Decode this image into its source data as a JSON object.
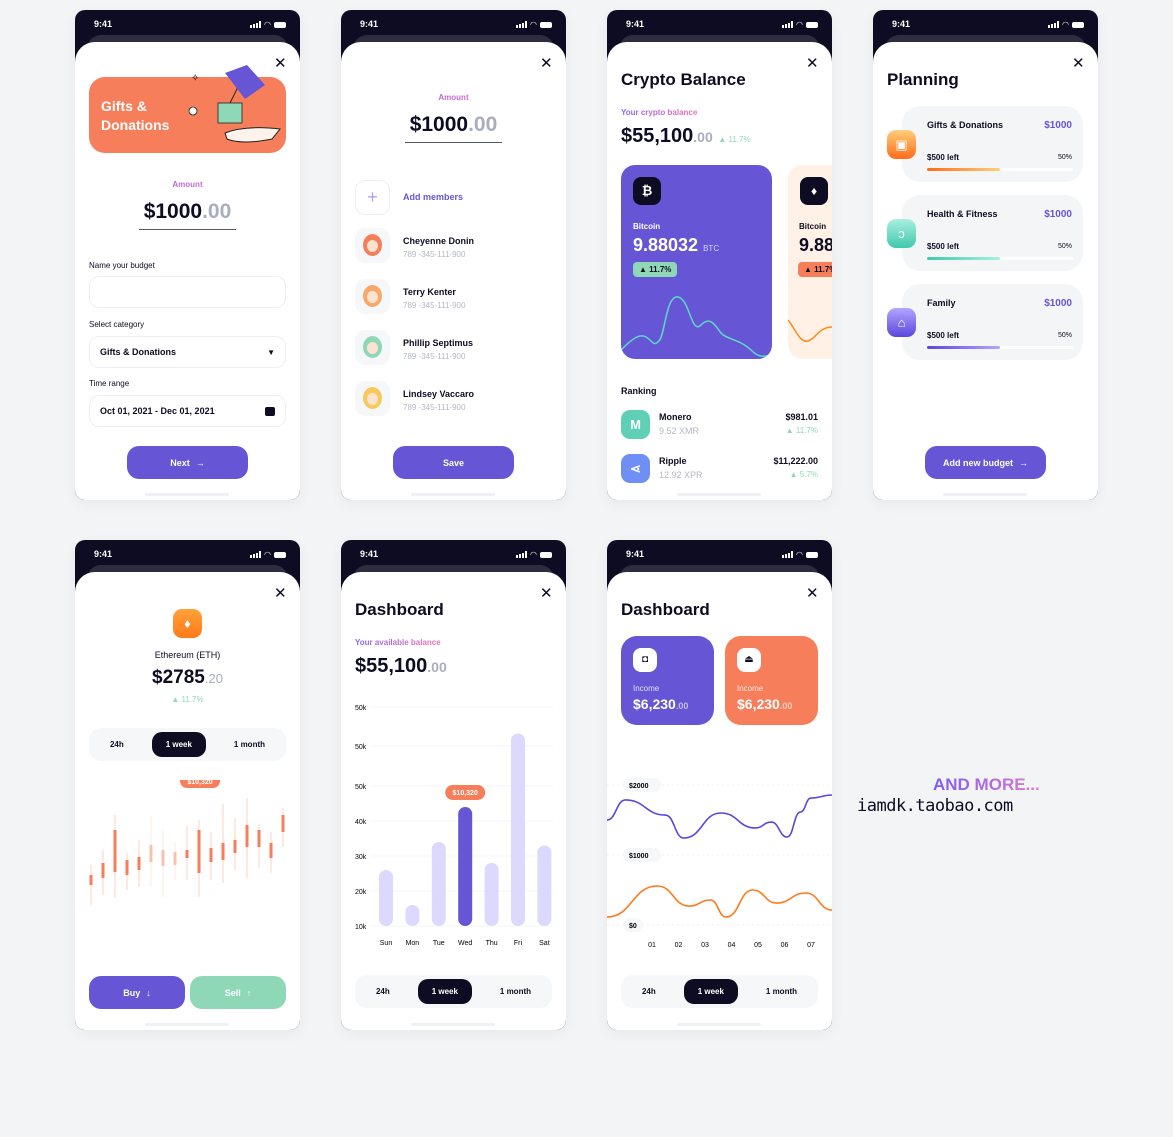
{
  "status": {
    "time": "9:41"
  },
  "colors": {
    "purple": "#6656d6",
    "orange": "#f77e5a",
    "green": "#8ed8b8",
    "dark": "#0d0c22"
  },
  "screen1": {
    "banner_title": "Gifts & Donations",
    "amount_label": "Amount",
    "amount": "$1000",
    "cents": ".00",
    "name_label": "Name your budget",
    "name_value": "",
    "category_label": "Select category",
    "category_value": "Gifts & Donations",
    "range_label": "Time range",
    "range_value": "Oct 01, 2021 - Dec 01, 2021",
    "next": "Next"
  },
  "screen2": {
    "amount_label": "Amount",
    "amount": "$1000",
    "cents": ".00",
    "add_members": "Add members",
    "members": [
      {
        "name": "Cheyenne Donin",
        "phone": "789 -345-111-900",
        "color": "#f77e5a"
      },
      {
        "name": "Terry Kenter",
        "phone": "789 -345-111-900",
        "color": "#f9a86a"
      },
      {
        "name": "Phillip Septimus",
        "phone": "789 -345-111-900",
        "color": "#8ed8b8"
      },
      {
        "name": "Lindsey Vaccaro",
        "phone": "789 -345-111-900",
        "color": "#f8c95a"
      }
    ],
    "save": "Save"
  },
  "screen3": {
    "title": "Crypto Balance",
    "balance_label": "Your crypto balance",
    "balance": "$55,100",
    "cents": ".00",
    "change": "11.7%",
    "card1": {
      "name": "Bitcoin",
      "amount": "9.88032",
      "unit": "BTC",
      "change": "11.7%",
      "icon": "bitcoin-icon"
    },
    "card2": {
      "name": "Bitcoin",
      "amount": "9.88",
      "change": "11.7%",
      "icon": "ethereum-icon"
    },
    "ranking_label": "Ranking",
    "ranking": [
      {
        "name": "Monero",
        "amount": "9.52 XMR",
        "value": "$981.01",
        "change": "11.7%",
        "icon": "monero-icon",
        "color": "#5fd0b6"
      },
      {
        "name": "Ripple",
        "amount": "12.92 XPR",
        "value": "$11,222.00",
        "change": "5.7%",
        "icon": "ripple-icon",
        "color": "#6f8ff5"
      }
    ]
  },
  "screen4": {
    "title": "Planning",
    "budgets": [
      {
        "name": "Gifts & Donations",
        "amount": "$1000",
        "left": "$500 left",
        "percent": "50%",
        "progress": 0.5,
        "icon": "gift-icon",
        "c1": "#ff6b1a",
        "c2": "#ffcf7a"
      },
      {
        "name": "Health & Fitness",
        "amount": "$1000",
        "left": "$500 left",
        "percent": "50%",
        "progress": 0.5,
        "icon": "muscle-icon",
        "c1": "#3fc9ad",
        "c2": "#a9f0e0"
      },
      {
        "name": "Family",
        "amount": "$1000",
        "left": "$500 left",
        "percent": "50%",
        "progress": 0.5,
        "icon": "home-icon",
        "c1": "#5a45dd",
        "c2": "#b3a6ff"
      }
    ],
    "add": "Add new budget"
  },
  "screen5": {
    "coin": "Ethereum (ETH)",
    "price": "$2785",
    "cents": ".20",
    "change": "11.7%",
    "tabs": [
      "24h",
      "1 week",
      "1 month"
    ],
    "active_tab": 1,
    "tooltip": "$10,320",
    "buy": "Buy",
    "sell": "Sell",
    "candles": [
      [
        35,
        -5,
        25,
        15
      ],
      [
        50,
        5,
        37,
        22
      ],
      [
        85,
        2,
        70,
        28
      ],
      [
        47,
        10,
        40,
        25
      ],
      [
        60,
        13,
        43,
        30
      ],
      [
        84,
        13,
        55,
        38,
        1
      ],
      [
        70,
        3,
        50,
        34,
        1
      ],
      [
        58,
        20,
        48,
        35,
        1
      ],
      [
        74,
        20,
        50,
        42
      ],
      [
        80,
        3,
        70,
        27
      ],
      [
        68,
        20,
        52,
        38
      ],
      [
        96,
        17,
        57,
        40
      ],
      [
        82,
        30,
        60,
        47
      ],
      [
        102,
        22,
        75,
        53
      ],
      [
        76,
        32,
        70,
        53
      ],
      [
        68,
        27,
        57,
        42
      ],
      [
        92,
        53,
        85,
        68
      ]
    ]
  },
  "screen6": {
    "title": "Dashboard",
    "balance_label": "Your available balance",
    "balance": "$55,100",
    "cents": ".00",
    "tabs": [
      "24h",
      "1 week",
      "1 month"
    ],
    "active_tab": 1
  },
  "chart_data": {
    "type": "bar",
    "categories": [
      "Sun",
      "Mon",
      "Tue",
      "Wed",
      "Thu",
      "Fri",
      "Sat"
    ],
    "values": [
      26000,
      16000,
      34000,
      44000,
      28000,
      65000,
      33000
    ],
    "highlight": "Wed",
    "tooltip": "$10,320",
    "yticks": [
      "50k",
      "50k",
      "50k",
      "40k",
      "30k",
      "20k",
      "10k"
    ],
    "ylim": [
      10000,
      72000
    ],
    "grid": true
  },
  "screen7": {
    "title": "Dashboard",
    "cards": [
      {
        "label": "Income",
        "amount": "$6,230",
        "cents": ".00",
        "icon": "wallet-in-icon",
        "color": "#6656d6"
      },
      {
        "label": "Income",
        "amount": "$6,230",
        "cents": ".00",
        "icon": "wallet-out-icon",
        "color": "#f77e5a"
      }
    ],
    "line_chart": {
      "type": "line",
      "yticks": [
        "$2000",
        "$1000",
        "$0"
      ],
      "xticks": [
        "01",
        "02",
        "03",
        "04",
        "05",
        "06",
        "07"
      ],
      "ylim": [
        0,
        2300
      ],
      "series": [
        {
          "color": "#5a45dd",
          "x": [
            -0.7,
            0,
            1.5,
            2.2,
            3.6,
            4.9,
            5.5,
            6.1,
            6.6,
            7.0,
            7.8
          ],
          "y": [
            1500,
            1786,
            1571,
            1243,
            1600,
            1386,
            1471,
            1257,
            1614,
            1814,
            1857
          ]
        },
        {
          "color": "#ff7a1a",
          "x": [
            -0.7,
            1.2,
            2.4,
            3.2,
            3.8,
            4.8,
            5.7,
            6.8,
            7.8
          ],
          "y": [
            114,
            557,
            271,
            357,
            114,
            500,
            314,
            457,
            214
          ]
        }
      ]
    },
    "tabs": [
      "24h",
      "1 week",
      "1 month"
    ],
    "active_tab": 1
  },
  "promo": {
    "more": "AND MORE...",
    "site": "iamdk.taobao.com"
  }
}
